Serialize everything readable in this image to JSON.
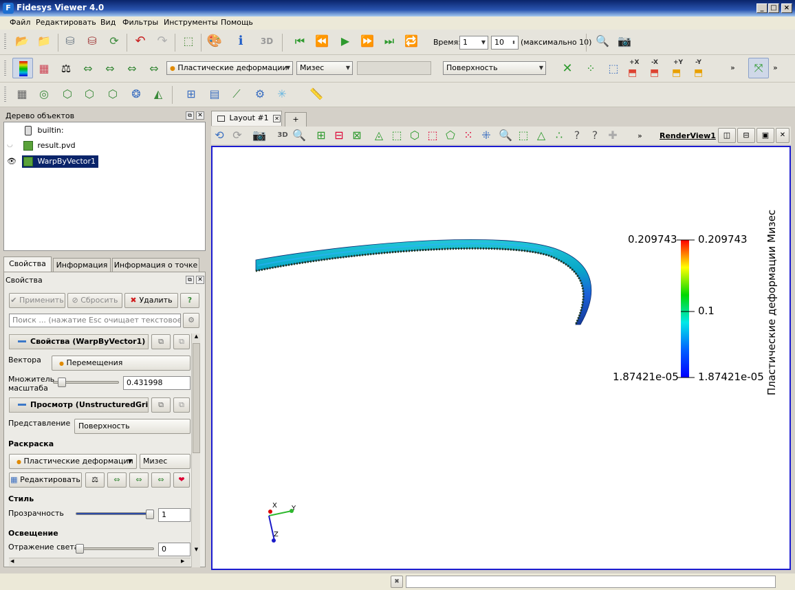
{
  "window": {
    "title": "Fidesys Viewer 4.0",
    "min": "_",
    "max": "□",
    "close": "×"
  },
  "menu": [
    "Файл",
    "Редактировать",
    "Вид",
    "Фильтры",
    "Инструменты",
    "Помощь"
  ],
  "time": {
    "label": "Время:",
    "value": "1",
    "step": "10",
    "max_text": "(максимально 10)"
  },
  "toolbar": {
    "three_d": "3D",
    "field_combo": "Пластические деформации",
    "component_combo": "Мизес",
    "representation_combo": "Поверхность",
    "more": "»",
    "axis_xp": "+X",
    "axis_xm": "-X",
    "axis_yp": "+Y",
    "axis_ym": "-Y"
  },
  "pipeline": {
    "title": "Дерево объектов",
    "items": [
      {
        "label": "builtin:"
      },
      {
        "label": "result.pvd"
      },
      {
        "label": "WarpByVector1"
      }
    ]
  },
  "tabs": {
    "properties": "Свойства",
    "information": "Информация",
    "point_info": "Информация о точке"
  },
  "properties": {
    "title": "Свойства",
    "apply": "Применить",
    "reset": "Сбросить",
    "delete": "Удалить",
    "help": "?",
    "search_placeholder": "Поиск ... (нажатие Esc очищает текстовое по...",
    "section_warp": "Свойства (WarpByVector1)",
    "vectors_label": "Вектора",
    "vectors_value": "Перемещения",
    "scale_label_1": "Множитель",
    "scale_label_2": "масштаба",
    "scale_value": "0.431998",
    "scale_fraction": 0.08,
    "section_display": "Просмотр (UnstructuredGrid",
    "representation_label": "Представление",
    "representation_value": "Поверхность",
    "coloring_header": "Раскраска",
    "coloring_field": "Пластические деформации",
    "coloring_component": "Мизес",
    "edit_button": "Редактировать",
    "style_header": "Стиль",
    "opacity_label": "Прозрачность",
    "opacity_value": "1",
    "opacity_fraction": 1.0,
    "lighting_header": "Освещение",
    "specular_label": "Отражение света",
    "specular_value": "0",
    "specular_fraction": 0.0
  },
  "layout": {
    "tab_label": "Layout #1",
    "add_tab": "+",
    "render_view": "RenderView1",
    "three_d": "3D",
    "more": "»"
  },
  "colorbar": {
    "title": "Пластические деформации Мизес",
    "max_label": "0.209743",
    "mid_label": "0.1",
    "min_label": "1.87421e-05"
  },
  "axes": {
    "x": "X",
    "y": "Y",
    "z": "Z"
  },
  "colors": {
    "accent": "#1b1bd0",
    "selection": "#0a246a"
  }
}
